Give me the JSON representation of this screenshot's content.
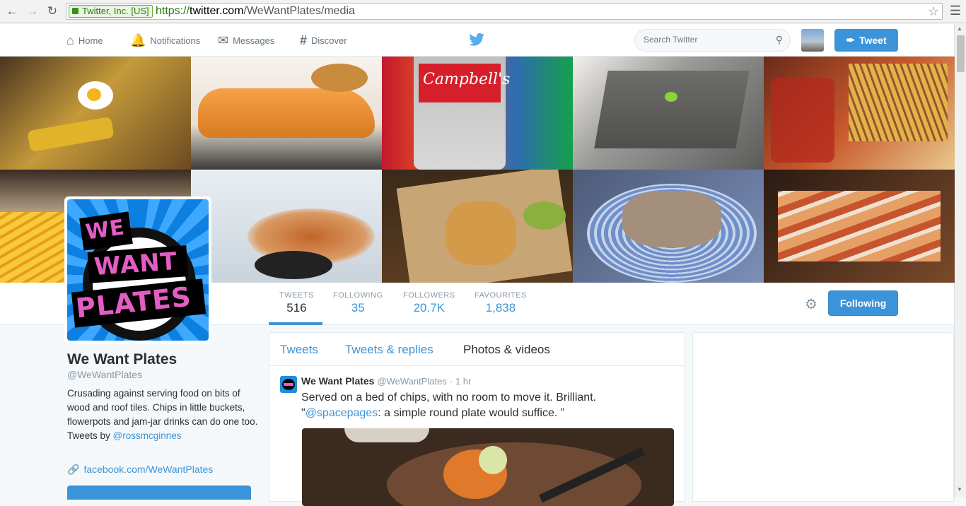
{
  "browser": {
    "ev_label": "Twitter, Inc. [US]",
    "url_protocol": "https://",
    "url_host": "twitter.com",
    "url_path": "/WeWantPlates/media"
  },
  "topbar": {
    "nav": [
      {
        "label": "Home",
        "icon": "home-icon"
      },
      {
        "label": "Notifications",
        "icon": "bell-icon"
      },
      {
        "label": "Messages",
        "icon": "envelope-icon"
      },
      {
        "label": "Discover",
        "icon": "hashtag-icon"
      }
    ],
    "search_placeholder": "Search Twitter",
    "tweet_button": "Tweet",
    "brand_color": "#55acee"
  },
  "profile": {
    "avatar_text": [
      "WE",
      "WANT",
      "PLATES"
    ],
    "name": "We Want Plates",
    "handle": "@WeWantPlates",
    "bio_text": "Crusading against serving food on bits of wood and roof tiles. Chips in little buckets, flowerpots and jam-jar drinks can do one too. Tweets by ",
    "bio_link": "@rossmcginnes",
    "website": "facebook.com/WeWantPlates"
  },
  "stats": [
    {
      "label": "TWEETS",
      "value": "516",
      "active": true
    },
    {
      "label": "FOLLOWING",
      "value": "35"
    },
    {
      "label": "FOLLOWERS",
      "value": "20.7K"
    },
    {
      "label": "FAVOURITES",
      "value": "1,838"
    }
  ],
  "follow_button": "Following",
  "tabs": [
    {
      "label": "Tweets"
    },
    {
      "label": "Tweets & replies"
    },
    {
      "label": "Photos & videos",
      "active": true
    }
  ],
  "tweet": {
    "name": "We Want Plates",
    "handle": "@WeWantPlates",
    "sep": "·",
    "time": "1 hr",
    "text": "Served on a bed of chips, with no room to move it. Brilliant.",
    "quote_open": "\"",
    "mention": "@spacepages",
    "quote_text": ": a simple round plate would suffice. ”"
  }
}
